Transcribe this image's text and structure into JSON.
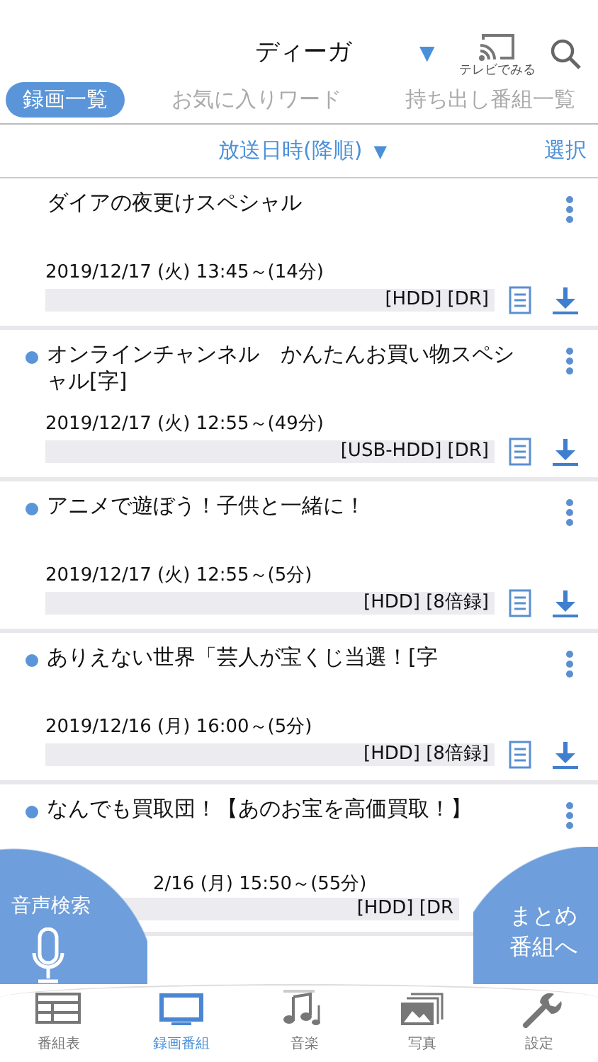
{
  "header": {
    "device": "ディーガ",
    "device_caret": "▼",
    "cast_label": "テレビでみる"
  },
  "tabs": [
    {
      "label": "録画一覧",
      "selected": true
    },
    {
      "label": "お気に入りワード",
      "selected": false
    },
    {
      "label": "持ち出し番組一覧",
      "selected": false
    }
  ],
  "sort": {
    "label": "放送日時(降順)",
    "caret": "▼",
    "select": "選択"
  },
  "recordings": [
    {
      "title": "ダイアの夜更けスペシャル",
      "unwatched": false,
      "datetime": "2019/12/17 (火)  13:45～(14分)",
      "info": "[HDD] [DR]"
    },
    {
      "title": "オンラインチャンネル　かんたんお買い物スペシャル[字]",
      "unwatched": true,
      "datetime": "2019/12/17 (火)  12:55～(49分)",
      "info": "[USB-HDD] [DR]"
    },
    {
      "title": "アニメで遊ぼう！子供と一緒に！",
      "unwatched": true,
      "datetime": "2019/12/17 (火)  12:55～(5分)",
      "info": "[HDD] [8倍録]"
    },
    {
      "title": "ありえない世界「芸人が宝くじ当選！[字",
      "unwatched": true,
      "datetime": "2019/12/16 (月)  16:00～(5分)",
      "info": "[HDD] [8倍録]"
    },
    {
      "title": "なんでも買取団！【あのお宝を高価買取！】",
      "unwatched": true,
      "datetime": "2/16 (月)  15:50～(55分)",
      "info": "[HDD] [DR"
    }
  ],
  "voice_search": {
    "label": "音声検索"
  },
  "summary_button": {
    "label": "まとめ番組へ"
  },
  "bottom_tabs": [
    {
      "label": "番組表",
      "selected": false
    },
    {
      "label": "録画番組",
      "selected": true
    },
    {
      "label": "音楽",
      "selected": false
    },
    {
      "label": "写真",
      "selected": false
    },
    {
      "label": "設定",
      "selected": false
    }
  ]
}
